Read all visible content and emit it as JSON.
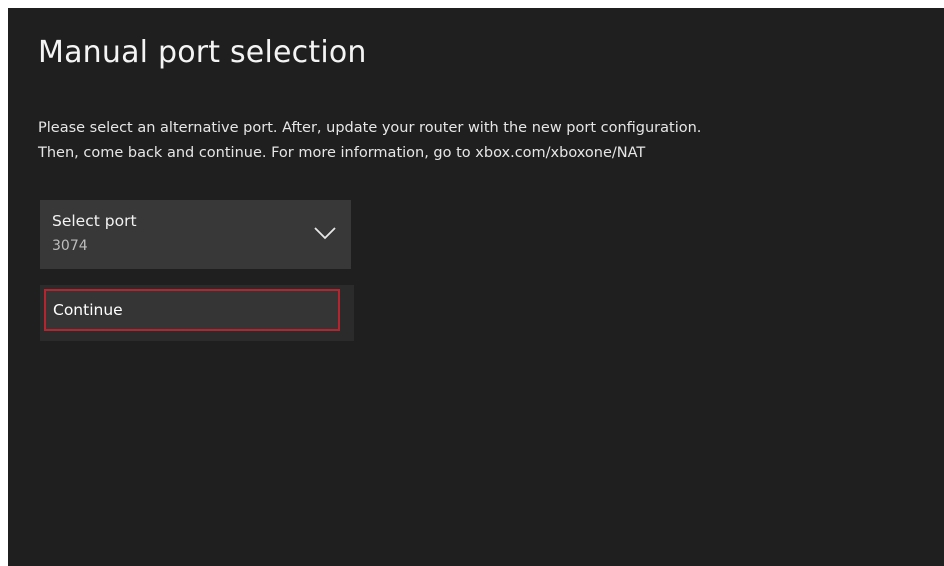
{
  "page": {
    "title": "Manual port selection",
    "instructions_line1": "Please select an alternative port. After, update your router with the new port configuration.",
    "instructions_line2": "Then, come back and continue. For more information, go to xbox.com/xboxone/NAT"
  },
  "port_select": {
    "label": "Select port",
    "value": "3074",
    "icon": "chevron-down-icon"
  },
  "actions": {
    "continue_label": "Continue"
  },
  "colors": {
    "background": "#1f1f1f",
    "dropdown_background": "#383838",
    "focus_border": "#b4252f",
    "text": "#ffffff"
  }
}
